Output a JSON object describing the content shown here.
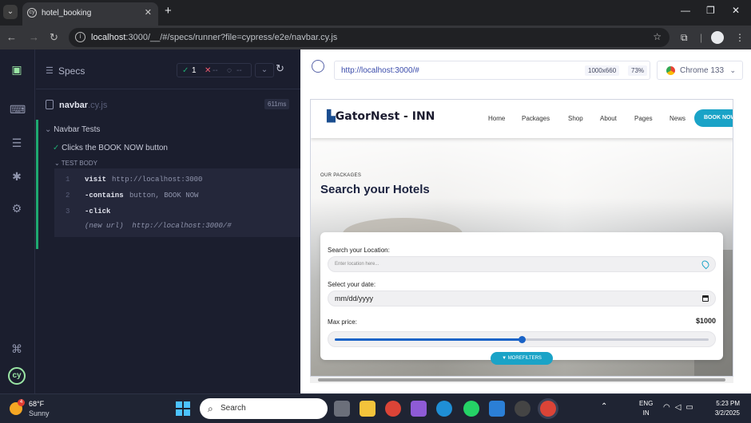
{
  "browser": {
    "tab_title": "hotel_booking",
    "url_host": "localhost",
    "url_rest": ":3000/__/#/specs/runner?file=cypress/e2e/navbar.cy.js"
  },
  "cypress": {
    "specs_title": "Specs",
    "passed_count": "1",
    "failed_count": "--",
    "pending_count": "--",
    "file_name": "navbar",
    "file_ext": ".cy.js",
    "duration": "611ms",
    "suite_title": "Navbar Tests",
    "test_title": "Clicks the BOOK NOW button",
    "test_body_label": "TEST BODY",
    "commands": [
      {
        "num": "1",
        "name": "visit",
        "value": "http://localhost:3000"
      },
      {
        "num": "2",
        "name": "-contains",
        "value": "button, BOOK NOW"
      },
      {
        "num": "3",
        "name": "-click",
        "value": ""
      }
    ],
    "new_url_label": "(new url)",
    "new_url_value": "http://localhost:3000/#",
    "runner_url": "http://localhost:3000/#",
    "viewport_size": "1000x660",
    "zoom": "73%",
    "browser_name": "Chrome 133"
  },
  "app": {
    "brand": "GatorNest - INN",
    "nav": [
      "Home",
      "Packages",
      "Shop",
      "About",
      "Pages",
      "News"
    ],
    "book_now": "BOOK NOW",
    "eyebrow": "OUR PACKAGES",
    "heading": "Search your Hotels",
    "location_label": "Search your Location:",
    "location_placeholder": "Enter location here...",
    "date_label": "Select your date:",
    "date_value": "mm/dd/yyyy",
    "price_label": "Max price:",
    "price_value": "$1000",
    "price_fraction": 0.5,
    "more_filters": "MOREFILTERS"
  },
  "taskbar": {
    "temperature": "68°F",
    "condition": "Sunny",
    "weather_badge": "4",
    "search_label": "Search",
    "lang_line1": "ENG",
    "lang_line2": "IN",
    "time": "5:23 PM",
    "date": "3/2/2025"
  }
}
